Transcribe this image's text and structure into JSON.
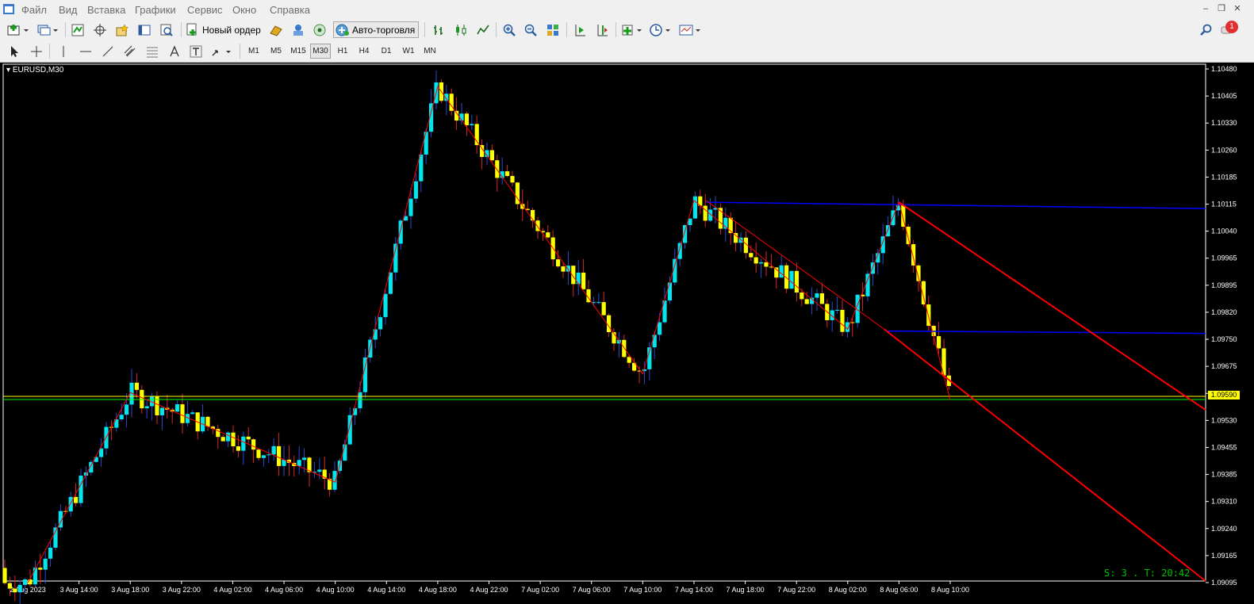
{
  "menu": {
    "items": [
      "Файл",
      "Вид",
      "Вставка",
      "Графики",
      "Сервис",
      "Окно",
      "Справка"
    ]
  },
  "toolbar": {
    "new_order_label": "Новый ордер",
    "autotrade_label": "Авто-торговля",
    "notification_count": "1"
  },
  "timeframes": [
    "M1",
    "M5",
    "M15",
    "M30",
    "H1",
    "H4",
    "D1",
    "W1",
    "MN"
  ],
  "active_timeframe": "M30",
  "chart": {
    "symbol_label": "EURUSD,M30",
    "current_price": "1.09590",
    "status_text": "S: 3 . T: 20:42",
    "price_axis_labels": [
      "1.10480",
      "1.10405",
      "1.10330",
      "1.10260",
      "1.10185",
      "1.10115",
      "1.10040",
      "1.09965",
      "1.09895",
      "1.09820",
      "1.09750",
      "1.09675",
      "1.09600",
      "1.09530",
      "1.09455",
      "1.09385",
      "1.09310",
      "1.09240",
      "1.09165",
      "1.09095"
    ],
    "time_axis_labels": [
      "2 Aug 2023",
      "3 Aug 14:00",
      "3 Aug 18:00",
      "3 Aug 22:00",
      "4 Aug 02:00",
      "4 Aug 06:00",
      "4 Aug 10:00",
      "4 Aug 14:00",
      "4 Aug 18:00",
      "4 Aug 22:00",
      "7 Aug 02:00",
      "7 Aug 06:00",
      "7 Aug 10:00",
      "7 Aug 14:00",
      "7 Aug 18:00",
      "7 Aug 22:00",
      "8 Aug 02:00",
      "8 Aug 06:00",
      "8 Aug 10:00"
    ],
    "colors": {
      "background": "#000000",
      "bull_candle": "#00e5ee",
      "bear_candle": "#ffff00",
      "zigzag": "#ff0000",
      "channel": "#ff0000",
      "horizontal_levels": "#0000ff",
      "bid_line": "#ffff00",
      "ask_line": "#00ff00",
      "axis_text": "#ffffff"
    },
    "price_range": [
      1.09095,
      1.1048
    ],
    "zigzag_points": [
      {
        "time": "2 Aug 2023",
        "price": 1.0909
      },
      {
        "time": "3 Aug 18:00",
        "price": 1.096
      },
      {
        "time": "4 Aug 10:00",
        "price": 1.0936
      },
      {
        "time": "4 Aug 18:00",
        "price": 1.1042
      },
      {
        "time": "7 Aug 10:00",
        "price": 1.0965
      },
      {
        "time": "7 Aug 14:00",
        "price": 1.10115
      },
      {
        "time": "8 Aug 02:00",
        "price": 1.0977
      },
      {
        "time": "8 Aug 06:00",
        "price": 1.1011
      },
      {
        "time": "8 Aug 10:00",
        "price": 1.0958
      }
    ],
    "horizontal_levels": [
      1.1011,
      1.09765
    ],
    "bid_price": 1.0959
  }
}
